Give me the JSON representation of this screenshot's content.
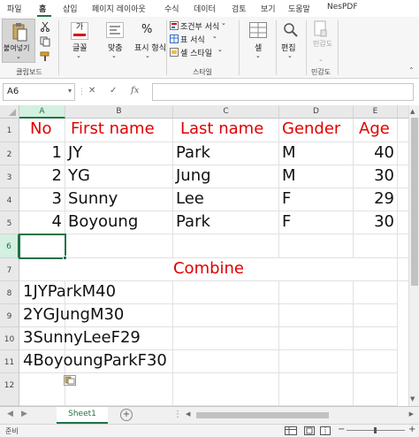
{
  "menu": {
    "items": [
      "파일",
      "홈",
      "삽입",
      "페이지 레이아웃",
      "수식",
      "데이터",
      "검토",
      "보기",
      "도움말",
      "NesPDF"
    ],
    "active": "홈"
  },
  "ribbon": {
    "clipboard": {
      "paste_label": "붙여넣기",
      "group_label": "클립보드"
    },
    "font": {
      "label": "글꼴"
    },
    "alignment": {
      "label": "맞춤"
    },
    "number": {
      "label": "표시 형식",
      "icon_text": "%"
    },
    "styles": {
      "conditional": "조건부 서식",
      "table_format": "표 서식",
      "cell_styles": "셀 스타일",
      "group_label": "스타일"
    },
    "cells": {
      "label": "셀"
    },
    "editing": {
      "label": "편집"
    },
    "sensitivity": {
      "button_label": "민감도",
      "group_label": "민감도"
    }
  },
  "formula_bar": {
    "name_box": "A6",
    "cancel": "✕",
    "enter": "✓",
    "fx": "fx",
    "content": ""
  },
  "columns": [
    "A",
    "B",
    "C",
    "D",
    "E"
  ],
  "rows": [
    "1",
    "2",
    "3",
    "4",
    "5",
    "6",
    "7",
    "8",
    "9",
    "10",
    "11",
    "12"
  ],
  "selected_cell": "A6",
  "table": {
    "header": [
      "No",
      "First name",
      "Last name",
      "Gender",
      "Age"
    ],
    "data": [
      [
        "1",
        "JY",
        "Park",
        "M",
        "40"
      ],
      [
        "2",
        "YG",
        "Jung",
        "M",
        "30"
      ],
      [
        "3",
        "Sunny",
        "Lee",
        "F",
        "29"
      ],
      [
        "4",
        "Boyoung",
        "Park",
        "F",
        "30"
      ]
    ]
  },
  "combine": {
    "title": "Combine",
    "results": [
      "1JYParkM40",
      "2YGJungM30",
      "3SunnyLeeF29",
      "4BoyoungParkF30"
    ]
  },
  "sheet_tabs": [
    "Sheet1"
  ],
  "status": {
    "ready": "준비"
  },
  "colors": {
    "accent": "#217346",
    "header_text": "#e00000"
  }
}
